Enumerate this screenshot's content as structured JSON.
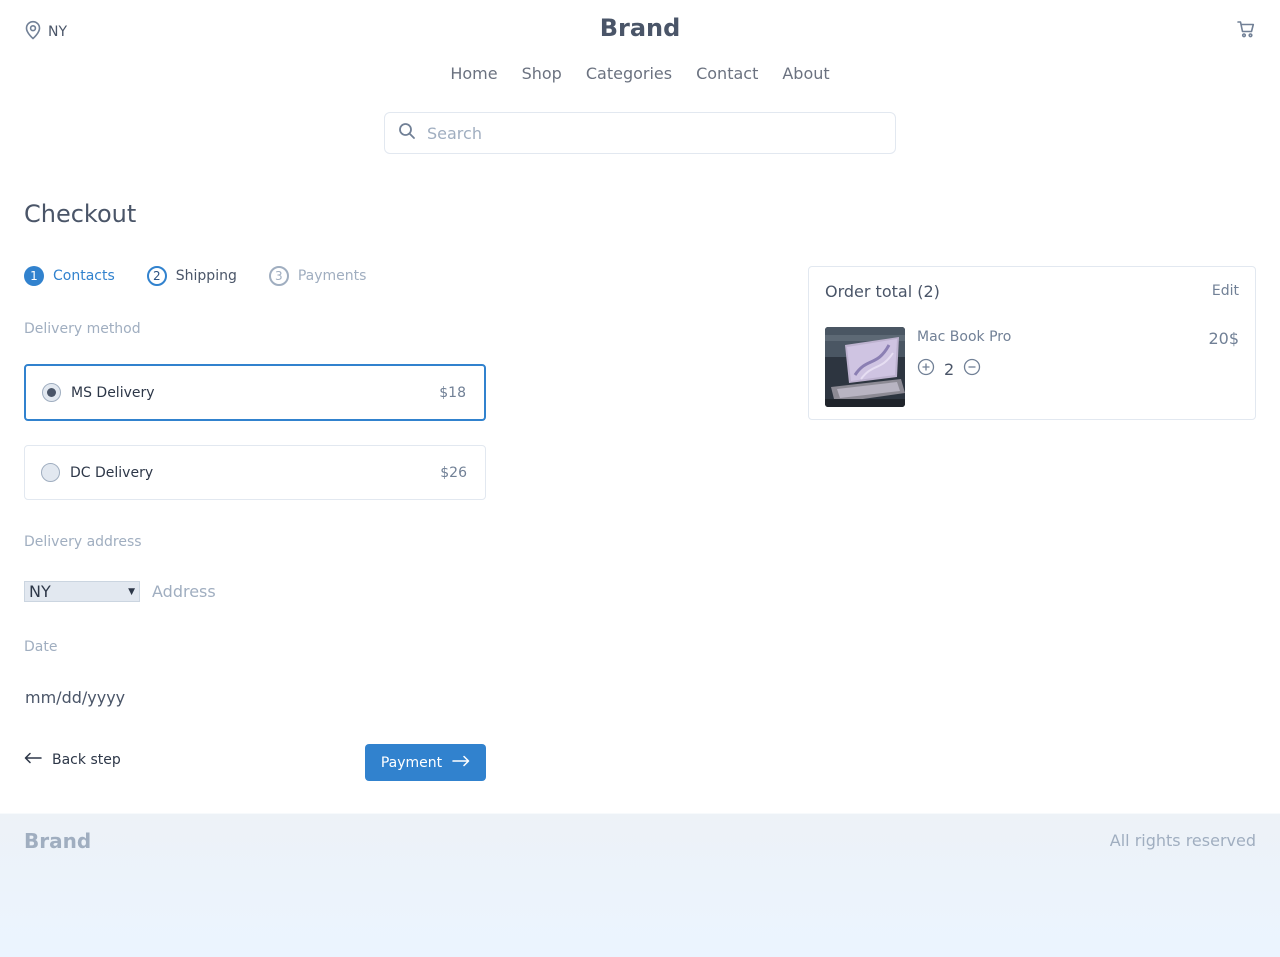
{
  "header": {
    "location": "NY",
    "brand": "Brand",
    "nav": [
      "Home",
      "Shop",
      "Categories",
      "Contact",
      "About"
    ],
    "search_placeholder": "Search"
  },
  "checkout": {
    "title": "Checkout",
    "steps": [
      {
        "num": "1",
        "label": "Contacts"
      },
      {
        "num": "2",
        "label": "Shipping"
      },
      {
        "num": "3",
        "label": "Payments"
      }
    ],
    "delivery_method_label": "Delivery method",
    "options": [
      {
        "name": "MS Delivery",
        "price": "$18",
        "selected": true
      },
      {
        "name": "DC Delivery",
        "price": "$26",
        "selected": false
      }
    ],
    "delivery_address_label": "Delivery address",
    "state_value": "NY",
    "address_placeholder": "Address",
    "date_label": "Date",
    "date_placeholder": "mm/dd/yyyy",
    "back_label": "Back step",
    "next_label": "Payment"
  },
  "order": {
    "title": "Order total (2)",
    "edit_label": "Edit",
    "item": {
      "name": "Mac Book Pro",
      "price": "20$",
      "quantity": "2"
    }
  },
  "footer": {
    "brand": "Brand",
    "rights": "All rights reserved"
  },
  "colors": {
    "accent": "#3182ce",
    "text": "#4a5568",
    "muted": "#a0aec0",
    "footer_bg": "#ebf4ff"
  }
}
